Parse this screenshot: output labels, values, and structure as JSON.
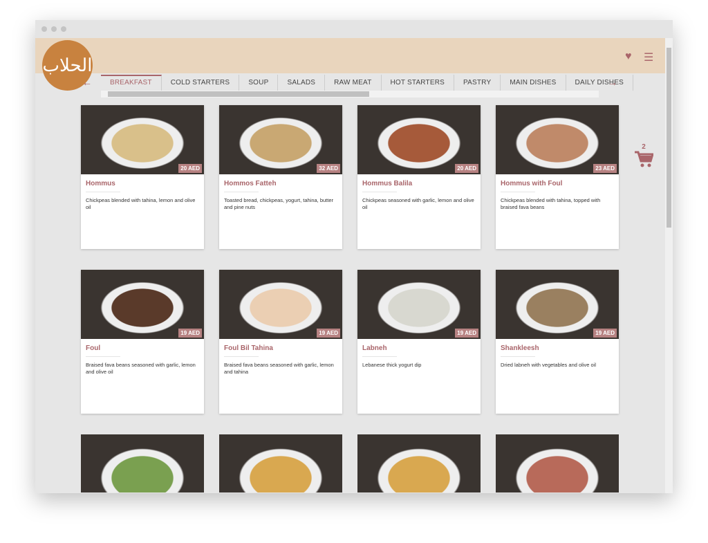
{
  "header": {
    "logo_text": "الحلاب",
    "icons": [
      "heart-icon",
      "menu-icon"
    ]
  },
  "tabs": [
    "BREAKFAST",
    "COLD STARTERS",
    "SOUP",
    "SALADS",
    "RAW MEAT",
    "HOT STARTERS",
    "PASTRY",
    "MAIN DISHES",
    "DAILY DISHES"
  ],
  "active_tab": "BREAKFAST",
  "cart": {
    "count": "2"
  },
  "items": [
    {
      "name": "Hommus",
      "price": "20 AED",
      "desc": "Chickpeas blended with tahina, lemon and olive oil",
      "color": "#d9c08a"
    },
    {
      "name": "Hommos Fatteh",
      "price": "32 AED",
      "desc": "Toasted bread, chickpeas, yogurt, tahina, butter and pine nuts",
      "color": "#c9a873"
    },
    {
      "name": "Hommus Balila",
      "price": "20 AED",
      "desc": "Chickpeas seasoned with garlic, lemon and olive oil",
      "color": "#a65a3a"
    },
    {
      "name": "Hommus with Foul",
      "price": "23 AED",
      "desc": "Chickpeas blended with tahina, topped with braised fava beans",
      "color": "#c08a6a"
    },
    {
      "name": "Foul",
      "price": "19 AED",
      "desc": "Braised fava beans seasoned with garlic, lemon and olive oil",
      "color": "#5a3a2a"
    },
    {
      "name": "Foul Bil Tahina",
      "price": "19 AED",
      "desc": "Braised fava beans seasoned with garlic, lemon and tahina",
      "color": "#ebcfb3"
    },
    {
      "name": "Labneh",
      "price": "19 AED",
      "desc": "Lebanese thick yogurt dip",
      "color": "#d8d8d0"
    },
    {
      "name": "Shankleesh",
      "price": "19 AED",
      "desc": "Dried labneh with vegetables and olive oil",
      "color": "#9a8060"
    },
    {
      "name": "",
      "price": "",
      "desc": "",
      "color": "#7aa050"
    },
    {
      "name": "",
      "price": "",
      "desc": "",
      "color": "#d9a850"
    },
    {
      "name": "",
      "price": "",
      "desc": "",
      "color": "#d9a850"
    },
    {
      "name": "",
      "price": "",
      "desc": "",
      "color": "#b86a5a"
    }
  ]
}
